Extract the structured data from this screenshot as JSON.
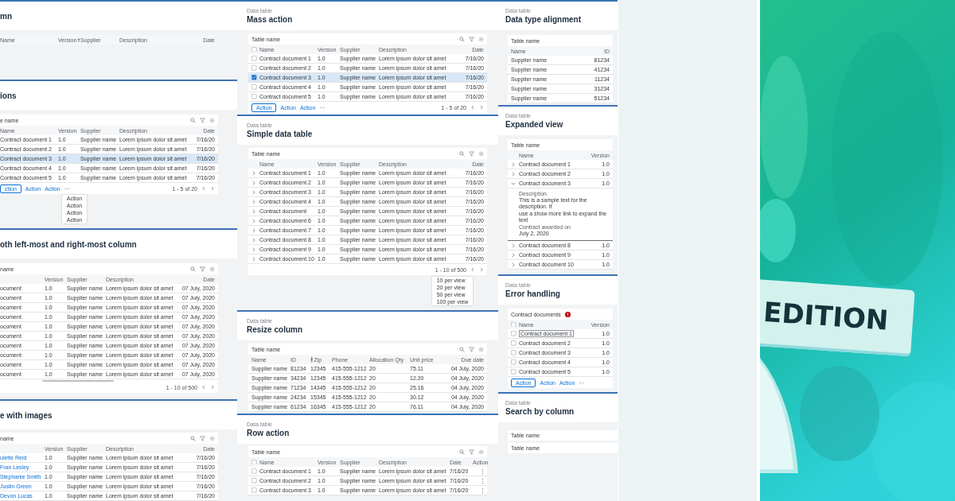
{
  "columns": [
    {
      "sections": [
        {
          "title": "mn",
          "tables": [
            {
              "kind": "sortable",
              "columns": [
                "Name",
                "Version",
                "Supplier",
                "Description",
                "Date"
              ]
            }
          ]
        },
        {
          "title": "ions",
          "tables": [
            {
              "kind": "documents",
              "name": "e name",
              "toolbar": true,
              "columns": [
                "Name",
                "Version",
                "Supplier",
                "Description",
                "Date"
              ],
              "rows": [
                {
                  "cells": [
                    "Contract document 1",
                    "1.0",
                    "Supplier name",
                    "Lorem ipsum dolor sit amet",
                    "7/16/20"
                  ],
                  "selected": false
                },
                {
                  "cells": [
                    "Contract document 2",
                    "1.0",
                    "Supplier name",
                    "Lorem ipsum dolor sit amet",
                    "7/16/20"
                  ],
                  "selected": false
                },
                {
                  "cells": [
                    "Contract document 3",
                    "1.0",
                    "Supplier name",
                    "Lorem ipsum dolor sit amet",
                    "7/16/20"
                  ],
                  "selected": true
                },
                {
                  "cells": [
                    "Contract document 4",
                    "1.0",
                    "Supplier name",
                    "Lorem ipsum dolor sit amet",
                    "7/16/20"
                  ],
                  "selected": false
                },
                {
                  "cells": [
                    "Contract document 5",
                    "1.0",
                    "Supplier name",
                    "Lorem ipsum dolor sit amet",
                    "7/16/20"
                  ],
                  "selected": false
                }
              ],
              "actions": [
                {
                  "label": "ction",
                  "kind": "outlined"
                },
                {
                  "label": "Action",
                  "kind": "text"
                },
                {
                  "label": "Action",
                  "kind": "text"
                },
                {
                  "label": "···",
                  "kind": "more"
                }
              ],
              "menu": [
                "Action",
                "Action",
                "Action",
                "Action"
              ],
              "pagination": "1 - 5 of 20"
            }
          ]
        },
        {
          "title": "oth left-most and right-most column",
          "tables": [
            {
              "kind": "frozen",
              "name": "name",
              "toolbar": true,
              "columns": [
                "",
                "Version",
                "Supplier",
                "Description",
                "Date"
              ],
              "rows": [
                {
                  "cells": [
                    "ocument",
                    "1.0",
                    "Supplier name",
                    "Lorem ipsum dolor sit amet",
                    "07 July, 2020"
                  ]
                },
                {
                  "cells": [
                    "ocument",
                    "1.0",
                    "Supplier name",
                    "Lorem ipsum dolor sit amet",
                    "07 July, 2020"
                  ]
                },
                {
                  "cells": [
                    "ocument",
                    "1.0",
                    "Supplier name",
                    "Lorem ipsum dolor sit amet",
                    "07 July, 2020"
                  ]
                },
                {
                  "cells": [
                    "ocument",
                    "1.0",
                    "Supplier name",
                    "Lorem ipsum dolor sit amet",
                    "07 July, 2020"
                  ]
                },
                {
                  "cells": [
                    "ocument",
                    "1.0",
                    "Supplier name",
                    "Lorem ipsum dolor sit amet",
                    "07 July, 2020"
                  ]
                },
                {
                  "cells": [
                    "ocument",
                    "1.0",
                    "Supplier name",
                    "Lorem ipsum dolor sit amet",
                    "07 July, 2020"
                  ]
                },
                {
                  "cells": [
                    "ocument",
                    "1.0",
                    "Supplier name",
                    "Lorem ipsum dolor sit amet",
                    "07 July, 2020"
                  ]
                },
                {
                  "cells": [
                    "ocument",
                    "1.0",
                    "Supplier name",
                    "Lorem ipsum dolor sit amet",
                    "07 July, 2020"
                  ]
                },
                {
                  "cells": [
                    "ocument",
                    "1.0",
                    "Supplier name",
                    "Lorem ipsum dolor sit amet",
                    "07 July, 2020"
                  ]
                },
                {
                  "cells": [
                    "ocument",
                    "1.0",
                    "Supplier name",
                    "Lorem ipsum dolor sit amet",
                    "07 July, 2020"
                  ]
                }
              ],
              "scrollbar": true,
              "pagination": "1 - 10 of 500"
            }
          ]
        },
        {
          "title": "e with images",
          "tables": [
            {
              "kind": "frozen",
              "name": "name",
              "toolbar": true,
              "link_first": true,
              "columns": [
                "",
                "Version",
                "Supplier",
                "Description",
                "Date"
              ],
              "rows": [
                {
                  "cells": [
                    "ulette Reid",
                    "1.0",
                    "Supplier name",
                    "Lorem ipsum dolor sit amet",
                    "7/16/20"
                  ]
                },
                {
                  "cells": [
                    "Fran Lesley",
                    "1.0",
                    "Supplier name",
                    "Lorem ipsum dolor sit amet",
                    "7/16/20"
                  ]
                },
                {
                  "cells": [
                    "Stephanie Smith",
                    "1.0",
                    "Supplier name",
                    "Lorem ipsum dolor sit amet",
                    "7/16/20"
                  ]
                },
                {
                  "cells": [
                    "Justin Green",
                    "1.0",
                    "Supplier name",
                    "Lorem ipsum dolor sit amet",
                    "7/16/20"
                  ]
                },
                {
                  "cells": [
                    "Devon Lucas",
                    "1.0",
                    "Supplier name",
                    "Lorem ipsum dolor sit amet",
                    "7/16/20"
                  ]
                }
              ]
            }
          ]
        }
      ]
    },
    {
      "sections": [
        {
          "label": "Data table",
          "title": "Mass action",
          "tables": [
            {
              "kind": "documents",
              "name": "Table name",
              "toolbar": true,
              "selection": true,
              "header_checked": false,
              "columns": [
                "Name",
                "Version",
                "Supplier",
                "Description",
                "Date"
              ],
              "rows": [
                {
                  "cells": [
                    "Contract document 1",
                    "1.0",
                    "Supplier name",
                    "Lorem ipsum dolor sit amet",
                    "7/16/20"
                  ],
                  "checked": false,
                  "selected": false
                },
                {
                  "cells": [
                    "Contract document 2",
                    "1.0",
                    "Supplier name",
                    "Lorem ipsum dolor sit amet",
                    "7/16/20"
                  ],
                  "checked": false,
                  "selected": false
                },
                {
                  "cells": [
                    "Contract document 3",
                    "1.0",
                    "Supplier name",
                    "Lorem ipsum dolor sit amet",
                    "7/16/20"
                  ],
                  "checked": true,
                  "selected": true
                },
                {
                  "cells": [
                    "Contract document 4",
                    "1.0",
                    "Supplier name",
                    "Lorem ipsum dolor sit amet",
                    "7/16/20"
                  ],
                  "checked": false,
                  "selected": false
                },
                {
                  "cells": [
                    "Contract document 5",
                    "1.0",
                    "Supplier name",
                    "Lorem ipsum dolor sit amet",
                    "7/16/20"
                  ],
                  "checked": false,
                  "selected": false
                }
              ],
              "actions": [
                {
                  "label": "Action",
                  "kind": "outlined"
                },
                {
                  "label": "Action",
                  "kind": "text"
                },
                {
                  "label": "Action",
                  "kind": "text"
                },
                {
                  "label": "···",
                  "kind": "more"
                }
              ],
              "pagination": "1 - 5 of 20"
            }
          ]
        },
        {
          "label": "Data table",
          "title": "Simple data table",
          "tables": [
            {
              "kind": "documents",
              "name": "Table name",
              "toolbar": true,
              "columns": [
                "Name",
                "Version",
                "Supplier",
                "Description",
                "Date"
              ],
              "rows": [
                {
                  "cells": [
                    "Contract document 1",
                    "1.0",
                    "Supplier name",
                    "Lorem ipsum dolor sit amet",
                    "7/16/20"
                  ],
                  "expanded": false
                },
                {
                  "cells": [
                    "Contract document 2",
                    "1.0",
                    "Supplier name",
                    "Lorem ipsum dolor sit amet",
                    "7/16/20"
                  ],
                  "expanded": false
                },
                {
                  "cells": [
                    "Contract document 3",
                    "1.0",
                    "Supplier name",
                    "Lorem ipsum dolor sit amet",
                    "7/16/20"
                  ],
                  "expanded": false
                },
                {
                  "cells": [
                    "Contract document 4",
                    "1.0",
                    "Supplier name",
                    "Lorem ipsum dolor sit amet",
                    "7/16/20"
                  ],
                  "expanded": false
                },
                {
                  "cells": [
                    "Contract document",
                    "1.0",
                    "Supplier name",
                    "Lorem ipsum dolor sit amet",
                    "7/16/20"
                  ],
                  "expanded": false
                },
                {
                  "cells": [
                    "Contract document 6",
                    "1.0",
                    "Supplier name",
                    "Lorem ipsum dolor sit amet",
                    "7/16/20"
                  ],
                  "expanded": false
                },
                {
                  "cells": [
                    "Contract document 7",
                    "1.0",
                    "Supplier name",
                    "Lorem ipsum dolor sit amet",
                    "7/16/20"
                  ],
                  "expanded": false
                },
                {
                  "cells": [
                    "Contract document 8",
                    "1.0",
                    "Supplier name",
                    "Lorem ipsum dolor sit amet",
                    "7/16/20"
                  ],
                  "expanded": false
                },
                {
                  "cells": [
                    "Contract document 9",
                    "1.0",
                    "Supplier name",
                    "Lorem ipsum dolor sit amet",
                    "7/16/20"
                  ],
                  "expanded": false
                },
                {
                  "cells": [
                    "Contract document 10",
                    "1.0",
                    "Supplier name",
                    "Lorem ipsum dolor sit amet",
                    "7/16/20"
                  ],
                  "expanded": false
                }
              ],
              "pagination": "1 - 10 of 500",
              "page_menu": [
                "10 per view",
                "20 per view",
                "50 per view",
                "100 per view"
              ]
            }
          ]
        },
        {
          "label": "Data table",
          "title": "Resize column",
          "tables": [
            {
              "kind": "resize",
              "name": "Table name",
              "toolbar": true,
              "columns": [
                "Name",
                "ID",
                "Zip",
                "Phone",
                "Allocation Qty",
                "Unit price",
                "Due date"
              ],
              "rows": [
                {
                  "cells": [
                    "Supplier name",
                    "81234",
                    "12345",
                    "415-555-1212",
                    "20",
                    "75.11",
                    "04 July, 2020"
                  ]
                },
                {
                  "cells": [
                    "Supplier name",
                    "34234",
                    "12345",
                    "415-555-1212",
                    "20",
                    "12.20",
                    "04 July, 2020"
                  ]
                },
                {
                  "cells": [
                    "Supplier name",
                    "71234",
                    "14345",
                    "415-555-1212",
                    "20",
                    "25.16",
                    "04 July, 2020"
                  ]
                },
                {
                  "cells": [
                    "Supplier name",
                    "24234",
                    "15345",
                    "415-555-1212",
                    "20",
                    "30.12",
                    "04 July, 2020"
                  ]
                },
                {
                  "cells": [
                    "Supplier name",
                    "61234",
                    "16345",
                    "415-555-1212",
                    "20",
                    "76.11",
                    "04 July, 2020"
                  ]
                }
              ]
            }
          ]
        },
        {
          "label": "Data table",
          "title": "Row action",
          "tables": [
            {
              "kind": "action",
              "name": "Table name",
              "toolbar": true,
              "selection": true,
              "header_checked": false,
              "row_menu": true,
              "columns": [
                "Name",
                "Version",
                "Supplier",
                "Description",
                "Date",
                "Action"
              ],
              "rows": [
                {
                  "cells": [
                    "Contract document 1",
                    "1.0",
                    "Supplier name",
                    "Lorem ipsum dolor sit amet",
                    "7/16/20"
                  ],
                  "checked": false
                },
                {
                  "cells": [
                    "Contract document 2",
                    "1.0",
                    "Supplier name",
                    "Lorem ipsum dolor sit amet",
                    "7/16/20"
                  ],
                  "checked": false
                },
                {
                  "cells": [
                    "Contract document 3",
                    "1.0",
                    "Supplier name",
                    "Lorem ipsum dolor sit amet",
                    "7/16/20"
                  ],
                  "checked": false
                }
              ]
            }
          ]
        }
      ]
    },
    {
      "sections": [
        {
          "label": "Data table",
          "title": "Data type alignment",
          "tables": [
            {
              "kind": "pair",
              "name": "Table name",
              "columns": [
                "Name",
                "ID"
              ],
              "rows": [
                {
                  "cells": [
                    "Supplier name",
                    "81234"
                  ]
                },
                {
                  "cells": [
                    "Supplier name",
                    "41234"
                  ]
                },
                {
                  "cells": [
                    "Supplier name",
                    "11234"
                  ]
                },
                {
                  "cells": [
                    "Supplier name",
                    "31234"
                  ]
                },
                {
                  "cells": [
                    "Supplier name",
                    "51234"
                  ]
                }
              ]
            }
          ]
        },
        {
          "label": "Data table",
          "title": "Expanded view",
          "tables": [
            {
              "kind": "pair",
              "name": "Table name",
              "columns": [
                "Name",
                "Version"
              ],
              "rows": [
                {
                  "cells": [
                    "Contract document 1",
                    "1.0"
                  ],
                  "expanded": false
                },
                {
                  "cells": [
                    "Contract document 2",
                    "1.0"
                  ],
                  "expanded": false
                },
                {
                  "cells": [
                    "Contract document 3",
                    "1.0"
                  ],
                  "expanded": true,
                  "detail": [
                    {
                      "kind": "label",
                      "text": "Description"
                    },
                    {
                      "kind": "text",
                      "text": "This is a sample text for the description. If"
                    },
                    {
                      "kind": "text",
                      "text": "use a show more link to expand the text"
                    },
                    {
                      "kind": "label",
                      "text": "Contract awarded on"
                    },
                    {
                      "kind": "text",
                      "text": "July 2, 2020"
                    }
                  ]
                },
                {
                  "cells": [
                    "Contract document 8",
                    "1.0"
                  ],
                  "expanded": false
                },
                {
                  "cells": [
                    "Contract document 9",
                    "1.0"
                  ],
                  "expanded": false
                },
                {
                  "cells": [
                    "Contract document 10",
                    "1.0"
                  ],
                  "expanded": false
                }
              ]
            }
          ]
        },
        {
          "label": "Data table",
          "title": "Error handling",
          "tables": [
            {
              "kind": "pair",
              "name": "Contract documents",
              "error": true,
              "selection": true,
              "header_checked": false,
              "columns": [
                "Name",
                "Version"
              ],
              "rows": [
                {
                  "cells": [
                    "Contract document 1",
                    "1.0"
                  ],
                  "checked": false,
                  "editing": true
                },
                {
                  "cells": [
                    "Contract document 2",
                    "1.0"
                  ],
                  "checked": false,
                  "editing": false
                },
                {
                  "cells": [
                    "Contract document 3",
                    "1.0"
                  ],
                  "checked": false,
                  "editing": false
                },
                {
                  "cells": [
                    "Contract document 4",
                    "1.0"
                  ],
                  "checked": false,
                  "editing": false
                },
                {
                  "cells": [
                    "Contract document 5",
                    "1.0"
                  ],
                  "checked": false,
                  "editing": false
                }
              ],
              "actions": [
                {
                  "label": "Action",
                  "kind": "outlined"
                },
                {
                  "label": "Action",
                  "kind": "text"
                },
                {
                  "label": "Action",
                  "kind": "text"
                },
                {
                  "label": "···",
                  "kind": "more"
                }
              ]
            }
          ]
        },
        {
          "label": "Data table",
          "title": "Search by column",
          "tables": [
            {
              "kind": "bar",
              "name": "Table name"
            },
            {
              "kind": "bar",
              "name": "Table name"
            }
          ]
        }
      ]
    }
  ],
  "promo": {
    "kind": "picture",
    "badge": "EDITION"
  }
}
